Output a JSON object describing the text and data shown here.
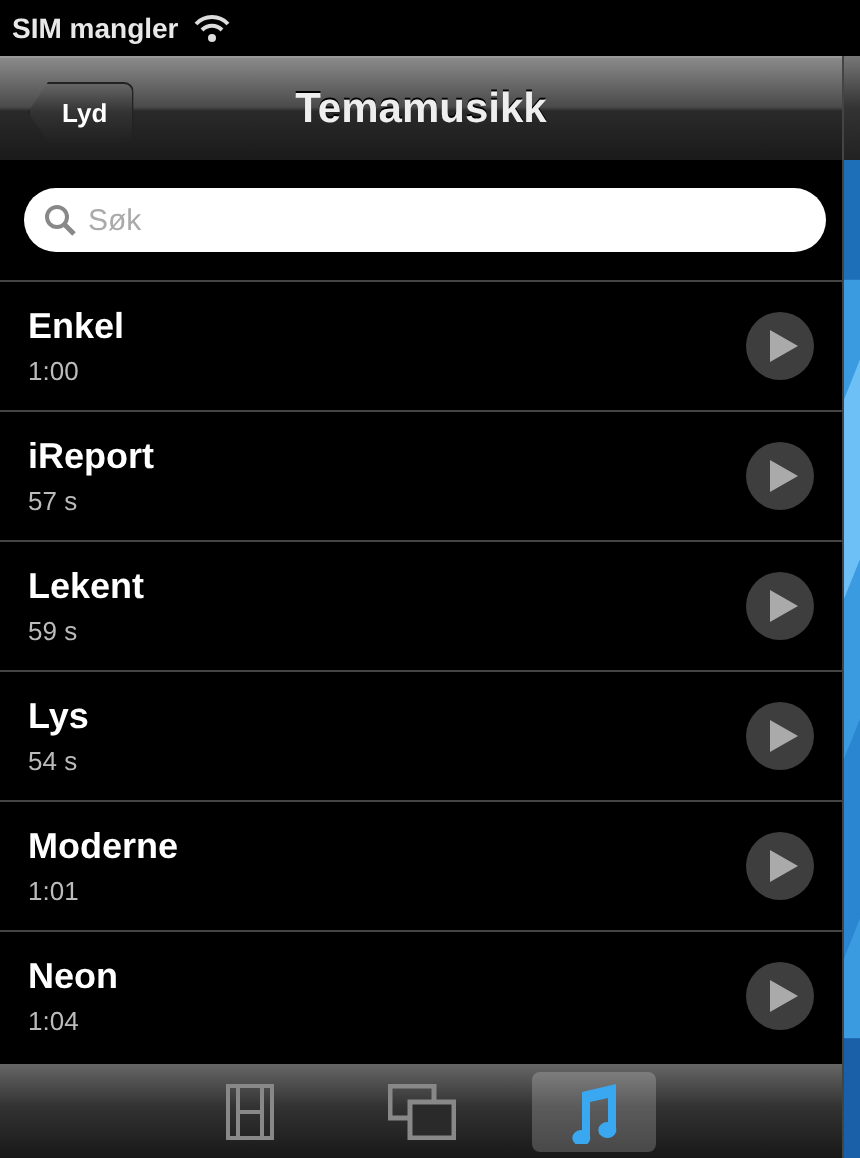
{
  "status_bar": {
    "carrier": "SIM mangler"
  },
  "nav_bar": {
    "back_button": "Lyd",
    "title": "Temamusikk"
  },
  "search": {
    "placeholder": "Søk"
  },
  "items": [
    {
      "title": "Enkel",
      "duration": "1:00"
    },
    {
      "title": "iReport",
      "duration": "57 s"
    },
    {
      "title": "Lekent",
      "duration": "59 s"
    },
    {
      "title": "Lys",
      "duration": "54 s"
    },
    {
      "title": "Moderne",
      "duration": "1:01"
    },
    {
      "title": "Neon",
      "duration": "1:04"
    }
  ],
  "tab_bar": [
    {
      "kind": "film",
      "selected": false
    },
    {
      "kind": "windows",
      "selected": false
    },
    {
      "kind": "music",
      "selected": true
    }
  ]
}
